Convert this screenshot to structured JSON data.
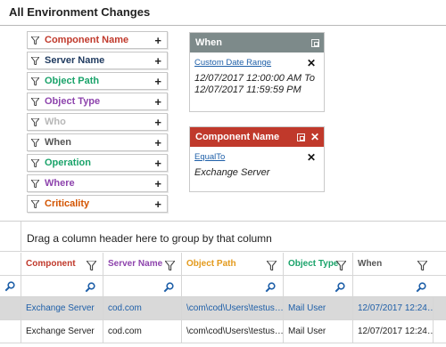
{
  "page": {
    "title": "All Environment Changes"
  },
  "filters": [
    {
      "label": "Component Name",
      "color": "#c0392b"
    },
    {
      "label": "Server Name",
      "color": "#1f3a5f"
    },
    {
      "label": "Object Path",
      "color": "#1aa36a"
    },
    {
      "label": "Object Type",
      "color": "#8e44ad"
    },
    {
      "label": "Who",
      "color": "#b7b7b7"
    },
    {
      "label": "When",
      "color": "#555555"
    },
    {
      "label": "Operation",
      "color": "#1aa36a"
    },
    {
      "label": "Where",
      "color": "#8e44ad"
    },
    {
      "label": "Criticality",
      "color": "#d35400"
    }
  ],
  "when_card": {
    "title": "When",
    "header_color": "#7d8a8a",
    "link": "Custom Date Range",
    "value_line1": "12/07/2017 12:00:00 AM To",
    "value_line2": "12/07/2017 11:59:59 PM"
  },
  "component_card": {
    "title": "Component Name",
    "header_color": "#c0392b",
    "link": "EqualTo",
    "value": "Exchange Server"
  },
  "grid": {
    "group_text": "Drag a column header here to group by that column",
    "columns": [
      {
        "label": "Component",
        "color": "#c0392b"
      },
      {
        "label": "Server Name",
        "color": "#8e44ad"
      },
      {
        "label": "Object Path",
        "color": "#e39a1c"
      },
      {
        "label": "Object Type",
        "color": "#1aa36a"
      },
      {
        "label": "When",
        "color": "#555555"
      }
    ],
    "rows": [
      [
        "Exchange Server",
        "cod.com",
        "\\com\\cod\\Users\\testus…",
        "Mail User",
        "12/07/2017 12:24…"
      ],
      [
        "Exchange Server",
        "cod.com",
        "\\com\\cod\\Users\\testus…",
        "Mail User",
        "12/07/2017 12:24…"
      ]
    ]
  }
}
